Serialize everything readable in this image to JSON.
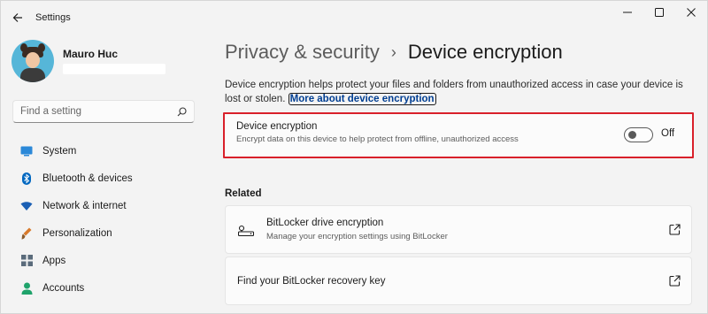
{
  "window": {
    "title": "Settings",
    "icons": {
      "back": "back-arrow-icon",
      "minimize": "minimize-icon",
      "maximize": "maximize-icon",
      "close": "close-icon"
    }
  },
  "profile": {
    "name": "Mauro Huc"
  },
  "search": {
    "placeholder": "Find a setting",
    "icon": "search-icon"
  },
  "sidebar": {
    "items": [
      {
        "label": "System",
        "icon": "system-icon",
        "color": "#0078d4"
      },
      {
        "label": "Bluetooth & devices",
        "icon": "bluetooth-icon",
        "color": "#0067c0"
      },
      {
        "label": "Network & internet",
        "icon": "wifi-icon",
        "color": "#1a5fb4"
      },
      {
        "label": "Personalization",
        "icon": "brush-icon",
        "color": "#d87a2b"
      },
      {
        "label": "Apps",
        "icon": "apps-icon",
        "color": "#5a6b7b"
      },
      {
        "label": "Accounts",
        "icon": "accounts-icon",
        "color": "#1fa36b"
      }
    ]
  },
  "main": {
    "breadcrumb_parent": "Privacy & security",
    "breadcrumb_separator": "›",
    "page_title": "Device encryption",
    "description": "Device encryption helps protect your files and folders from unauthorized access in case your device is lost or stolen.",
    "description_link": "More about device encryption",
    "encryption_card": {
      "title": "Device encryption",
      "subtitle": "Encrypt data on this device to help protect from offline, unauthorized access",
      "toggle_state": "Off",
      "highlight_color": "#d9202a"
    },
    "related_heading": "Related",
    "related": [
      {
        "title": "BitLocker drive encryption",
        "subtitle": "Manage your encryption settings using BitLocker",
        "icon": "key-drive-icon",
        "link_icon": "external-link-icon"
      },
      {
        "title": "Find your BitLocker recovery key",
        "link_icon": "external-link-icon"
      }
    ]
  },
  "colors": {
    "accent": "#0067c0",
    "link": "#003e92",
    "background": "#f3f3f3",
    "card": "#fbfbfb"
  }
}
